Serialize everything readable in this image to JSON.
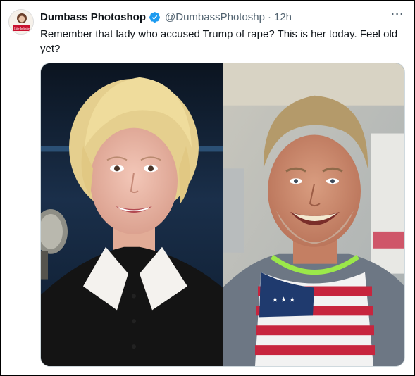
{
  "tweet": {
    "display_name": "Dumbass Photoshop",
    "handle": "@DumbassPhotoshp",
    "separator": "·",
    "time": "12h",
    "text": "Remember that lady who accused Trump of rape? This is her today. Feel old yet?",
    "more_glyph": "···",
    "verified_color": "#1d9bf0"
  },
  "avatar": {
    "icon": "avatar-logo-icon",
    "badge_text": "Life Infinite"
  },
  "media": {
    "left_photo": "woman-portrait-photo",
    "right_photo": "man-portrait-photo"
  }
}
